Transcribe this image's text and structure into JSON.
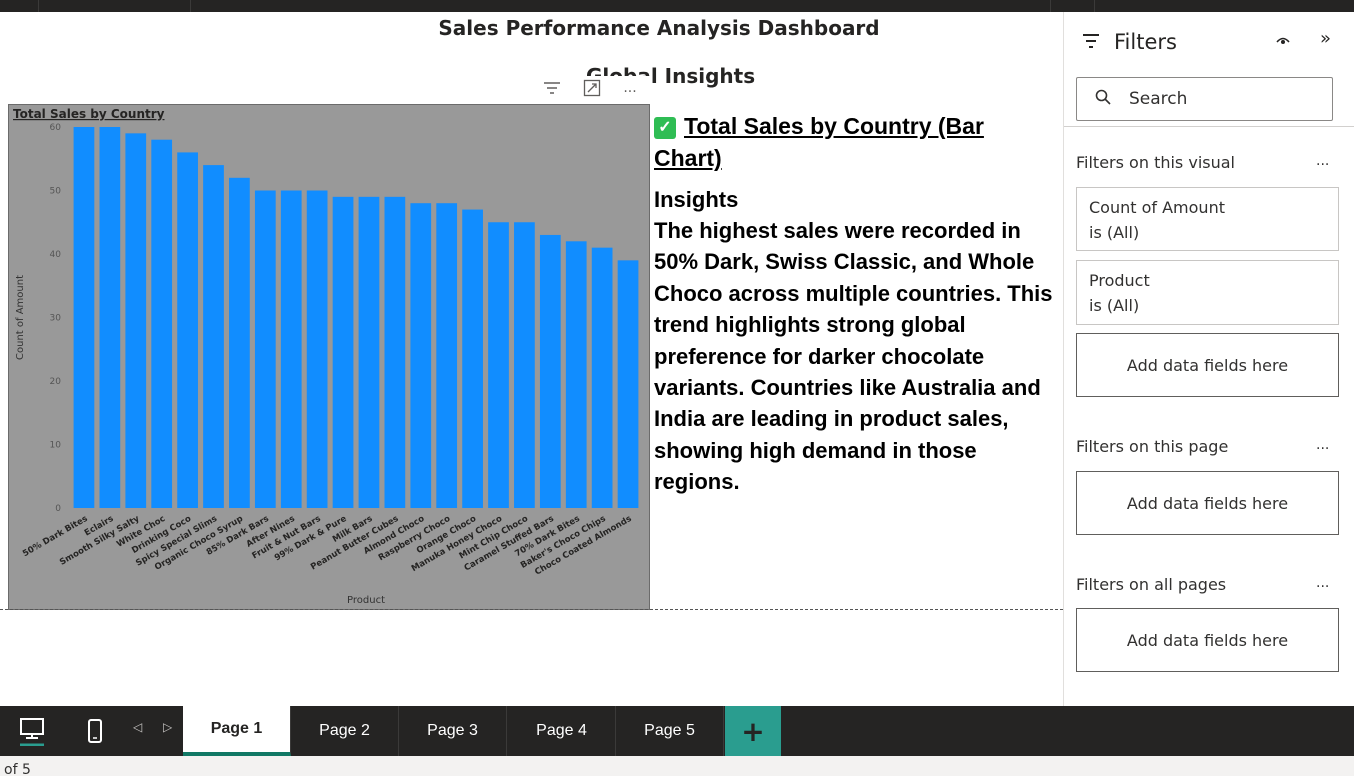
{
  "dashboard": {
    "title": "Sales Performance Analysis Dashboard",
    "section_title": "Global Insights"
  },
  "visual_header": {
    "filter_icon": "filter-icon",
    "focus_icon": "focus-mode-icon",
    "more": "..."
  },
  "chart_data": {
    "type": "bar",
    "title": "Total Sales by Country",
    "xlabel": "Product",
    "ylabel": "Count of Amount",
    "ylim": [
      0,
      60
    ],
    "yticks": [
      0,
      10,
      20,
      30,
      40,
      50,
      60
    ],
    "categories": [
      "50% Dark Bites",
      "Eclairs",
      "Smooth Silky Salty",
      "White Choc",
      "Drinking Coco",
      "Spicy Special Slims",
      "Organic Choco Syrup",
      "85% Dark Bars",
      "After Nines",
      "Fruit & Nut Bars",
      "99% Dark & Pure",
      "Milk Bars",
      "Peanut Butter Cubes",
      "Almond Choco",
      "Raspberry Choco",
      "Orange Choco",
      "Manuka Honey Choco",
      "Mint Chip Choco",
      "Caramel Stuffed Bars",
      "70% Dark Bites",
      "Baker's Choco Chips",
      "Choco Coated Almonds"
    ],
    "values": [
      60,
      60,
      59,
      58,
      56,
      54,
      52,
      50,
      50,
      50,
      49,
      49,
      49,
      48,
      48,
      47,
      45,
      45,
      43,
      42,
      41,
      39
    ],
    "bar_color": "#118DFF",
    "background": "#999999",
    "grid": false
  },
  "insights": {
    "heading": "Total Sales by Country (Bar Chart)",
    "subheading": "Insights",
    "body": "The highest sales were recorded in 50% Dark, Swiss Classic, and Whole Choco across multiple countries. This trend highlights strong global preference for darker chocolate variants. Countries like Australia and India are leading in product sales, showing high demand in those regions."
  },
  "filters": {
    "title": "Filters",
    "search_placeholder": "Search",
    "visual_section": "Filters on this visual",
    "page_section": "Filters on this page",
    "all_section": "Filters on all pages",
    "more": "...",
    "cards": [
      {
        "field": "Count of Amount",
        "state": "is (All)"
      },
      {
        "field": "Product",
        "state": "is (All)"
      }
    ],
    "drop_label": "Add data fields here"
  },
  "tabs": [
    "Page 1",
    "Page 2",
    "Page 3",
    "Page 4",
    "Page 5"
  ],
  "active_tab": "Page 1",
  "add_tab": "+",
  "status": {
    "text": "of 5"
  }
}
